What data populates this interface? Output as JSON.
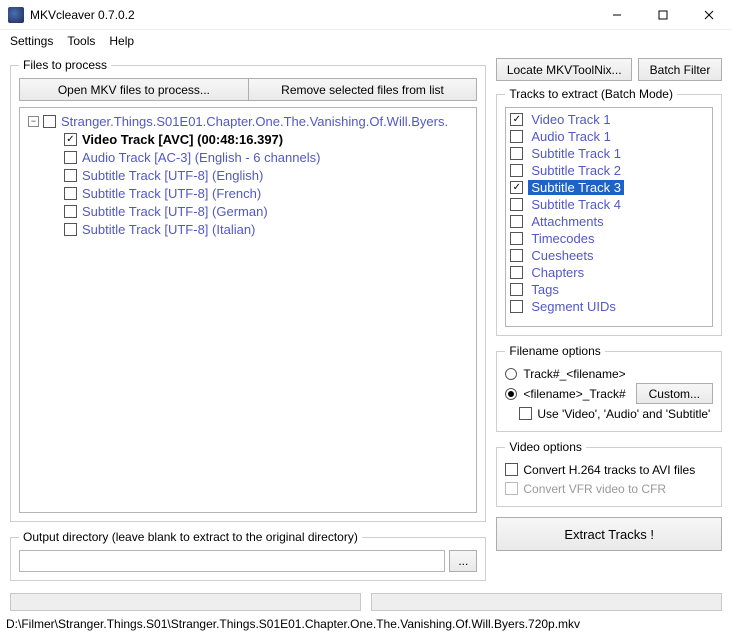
{
  "window": {
    "title": "MKVcleaver 0.7.0.2"
  },
  "menu": {
    "settings": "Settings",
    "tools": "Tools",
    "help": "Help"
  },
  "files_group": {
    "legend": "Files to process",
    "open_btn": "Open MKV files to process...",
    "remove_btn": "Remove selected files from list",
    "file": {
      "label": "Stranger.Things.S01E01.Chapter.One.The.Vanishing.Of.Will.Byers.",
      "tracks": [
        {
          "label": "Video Track [AVC] (00:48:16.397)",
          "checked": true,
          "selected": true
        },
        {
          "label": "Audio Track [AC-3] (English - 6 channels)",
          "checked": false,
          "selected": false
        },
        {
          "label": "Subtitle Track [UTF-8] (English)",
          "checked": false,
          "selected": false
        },
        {
          "label": "Subtitle Track [UTF-8] (French)",
          "checked": false,
          "selected": false
        },
        {
          "label": "Subtitle Track [UTF-8] (German)",
          "checked": false,
          "selected": false
        },
        {
          "label": "Subtitle Track [UTF-8] (Italian)",
          "checked": false,
          "selected": false
        }
      ]
    }
  },
  "right_top": {
    "locate": "Locate MKVToolNix...",
    "batch": "Batch Filter"
  },
  "tracks_group": {
    "legend": "Tracks to extract (Batch Mode)",
    "items": [
      {
        "label": "Video Track 1",
        "checked": true,
        "selected": false
      },
      {
        "label": "Audio Track 1",
        "checked": false,
        "selected": false
      },
      {
        "label": "Subtitle Track 1",
        "checked": false,
        "selected": false
      },
      {
        "label": "Subtitle Track 2",
        "checked": false,
        "selected": false
      },
      {
        "label": "Subtitle Track 3",
        "checked": true,
        "selected": true
      },
      {
        "label": "Subtitle Track 4",
        "checked": false,
        "selected": false
      },
      {
        "label": "Attachments",
        "checked": false,
        "selected": false
      },
      {
        "label": "Timecodes",
        "checked": false,
        "selected": false
      },
      {
        "label": "Cuesheets",
        "checked": false,
        "selected": false
      },
      {
        "label": "Chapters",
        "checked": false,
        "selected": false
      },
      {
        "label": "Tags",
        "checked": false,
        "selected": false
      },
      {
        "label": "Segment UIDs",
        "checked": false,
        "selected": false
      }
    ]
  },
  "filename_opts": {
    "legend": "Filename options",
    "radio1": "Track#_<filename>",
    "radio2": "<filename>_Track#",
    "custom_btn": "Custom...",
    "use_names": "Use 'Video', 'Audio' and 'Subtitle'"
  },
  "video_opts": {
    "legend": "Video options",
    "h264": "Convert H.264 tracks to AVI files",
    "vfr": "Convert VFR video to CFR"
  },
  "outdir": {
    "legend": "Output directory (leave blank to extract to the original directory)",
    "value": "",
    "browse": "..."
  },
  "extract_btn": "Extract Tracks !",
  "statusbar": "D:\\Filmer\\Stranger.Things.S01\\Stranger.Things.S01E01.Chapter.One.The.Vanishing.Of.Will.Byers.720p.mkv"
}
